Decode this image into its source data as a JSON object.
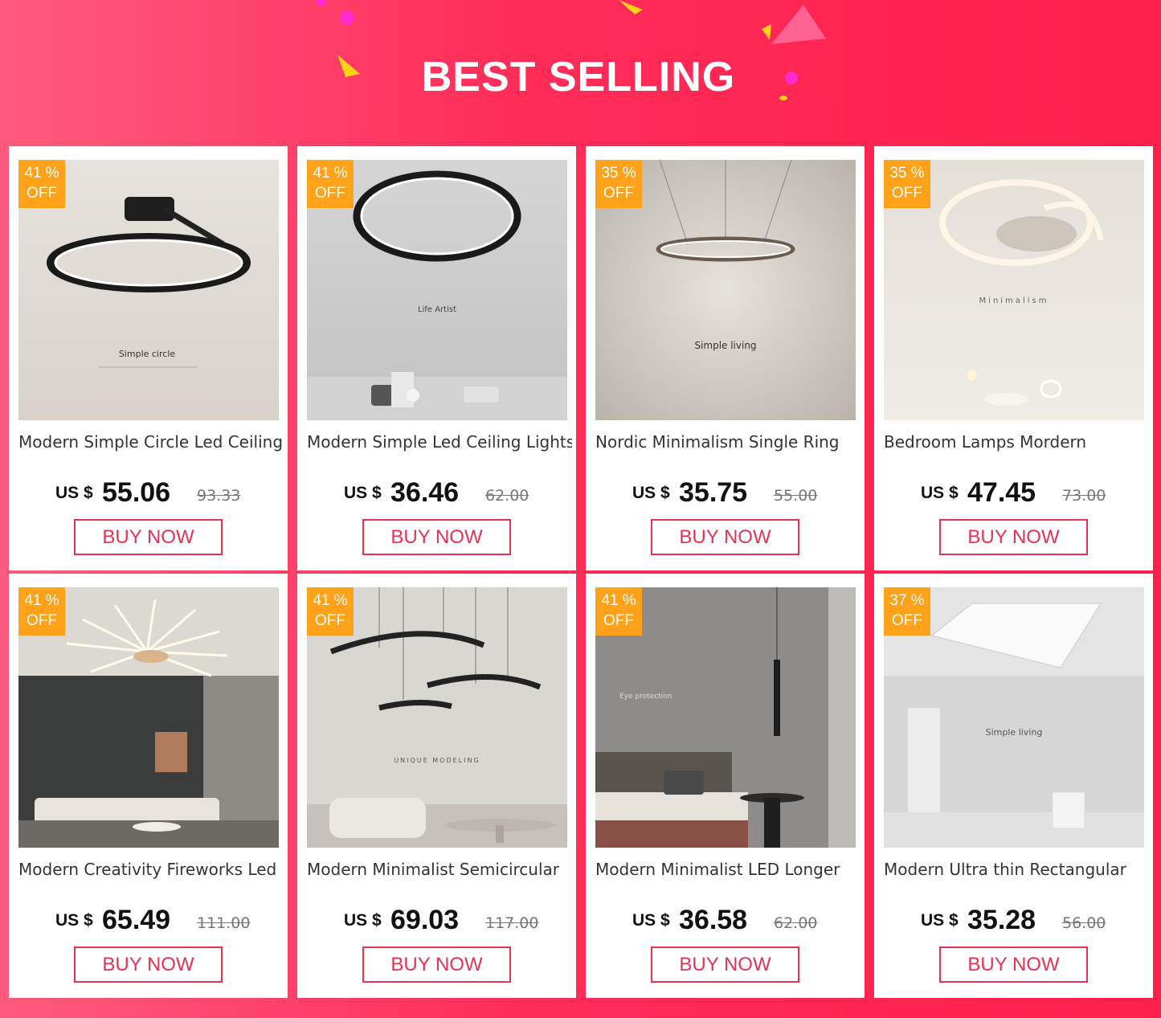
{
  "banner": {
    "title": "BEST SELLING"
  },
  "colors": {
    "background": "#ff2c58",
    "badge": "#ffa21a",
    "button": "#e63355"
  },
  "products": [
    {
      "discount": "41 %",
      "off": "OFF",
      "name": "Modern Simple Circle Led Ceiling",
      "currency": "US $",
      "price": "55.06",
      "old_price": "93.33",
      "button": "BUY NOW",
      "image_text": "Simple circle"
    },
    {
      "discount": "41 %",
      "off": "OFF",
      "name": "Modern Simple Led Ceiling Lights",
      "currency": "US $",
      "price": "36.46",
      "old_price": "62.00",
      "button": "BUY NOW",
      "image_text": "Life Artist"
    },
    {
      "discount": "35 %",
      "off": "OFF",
      "name": "Nordic Minimalism Single Ring",
      "currency": "US $",
      "price": "35.75",
      "old_price": "55.00",
      "button": "BUY NOW",
      "image_text": "Simple living"
    },
    {
      "discount": "35 %",
      "off": "OFF",
      "name": "Bedroom Lamps  Mordern",
      "currency": "US $",
      "price": "47.45",
      "old_price": "73.00",
      "button": "BUY NOW",
      "image_text": "Minimalism"
    },
    {
      "discount": "41 %",
      "off": "OFF",
      "name": "Modern Creativity Fireworks Led",
      "currency": "US $",
      "price": "65.49",
      "old_price": "111.00",
      "button": "BUY NOW",
      "image_text": ""
    },
    {
      "discount": "41 %",
      "off": "OFF",
      "name": "Modern Minimalist Semicircular",
      "currency": "US $",
      "price": "69.03",
      "old_price": "117.00",
      "button": "BUY NOW",
      "image_text": "UNIQUE MODELING"
    },
    {
      "discount": "41 %",
      "off": "OFF",
      "name": "Modern Minimalist LED Longer",
      "currency": "US $",
      "price": "36.58",
      "old_price": "62.00",
      "button": "BUY NOW",
      "image_text": "Eye protection"
    },
    {
      "discount": "37 %",
      "off": "OFF",
      "name": "Modern Ultra thin Rectangular",
      "currency": "US $",
      "price": "35.28",
      "old_price": "56.00",
      "button": "BUY NOW",
      "image_text": "Simple living"
    }
  ]
}
